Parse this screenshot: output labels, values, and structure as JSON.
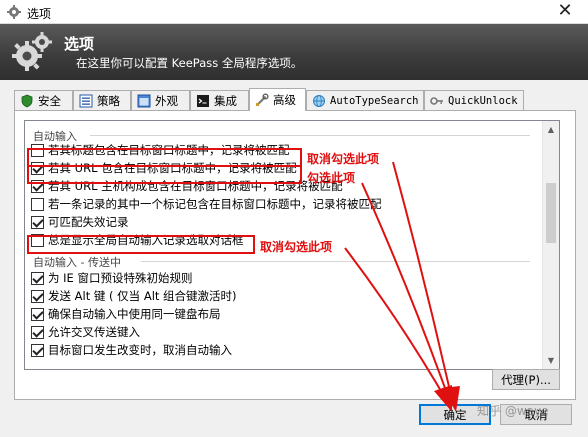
{
  "window": {
    "title": "选项",
    "close_glyph": "✕"
  },
  "banner": {
    "title": "选项",
    "subtitle": "在这里你可以配置 KeePass 全局程序选项。"
  },
  "tabs": [
    {
      "label": "安全",
      "icon": "shield-icon"
    },
    {
      "label": "策略",
      "icon": "list-icon"
    },
    {
      "label": "外观",
      "icon": "window-icon"
    },
    {
      "label": "集成",
      "icon": "console-icon"
    },
    {
      "label": "高级",
      "icon": "tools-icon",
      "active": true
    },
    {
      "label": "AutoTypeSearch",
      "icon": "globe-icon"
    },
    {
      "label": "QuickUnlock",
      "icon": "key-icon"
    }
  ],
  "groups": [
    "自动输入",
    "自动输入 - 传送中"
  ],
  "items": [
    {
      "label": "若其标题包含在目标窗口标题中，记录将被匹配",
      "checked": false
    },
    {
      "label": "若其 URL 包含在目标窗口标题中，记录将被匹配",
      "checked": true
    },
    {
      "label": "若其 URL 主机构成包含在目标窗口标题中，记录将被匹配",
      "checked": true
    },
    {
      "label": "若一条记录的其中一个标记包含在目标窗口标题中，记录将被匹配",
      "checked": false
    },
    {
      "label": "可匹配失效记录",
      "checked": true
    },
    {
      "label": "总是显示全局自动输入记录选取对话框",
      "checked": false
    },
    {
      "label": "为 IE 窗口预设特殊初始规则",
      "checked": true
    },
    {
      "label": "发送 Alt 键 ( 仅当 Alt 组合键激活时)",
      "checked": true
    },
    {
      "label": "确保自动输入中使用同一键盘布局",
      "checked": true
    },
    {
      "label": "允许交叉传送键入",
      "checked": true
    },
    {
      "label": "目标窗口发生改变时，取消自动输入",
      "checked": true
    }
  ],
  "buttons": {
    "proxy": "代理(P)...",
    "ok": "确定",
    "cancel": "取消"
  },
  "annotations": {
    "uncheck_1": "取消勾选此项",
    "check": "勾选此项",
    "uncheck_2": "取消勾选此项",
    "color": "#e01010"
  },
  "watermark": "知乎 @waye"
}
